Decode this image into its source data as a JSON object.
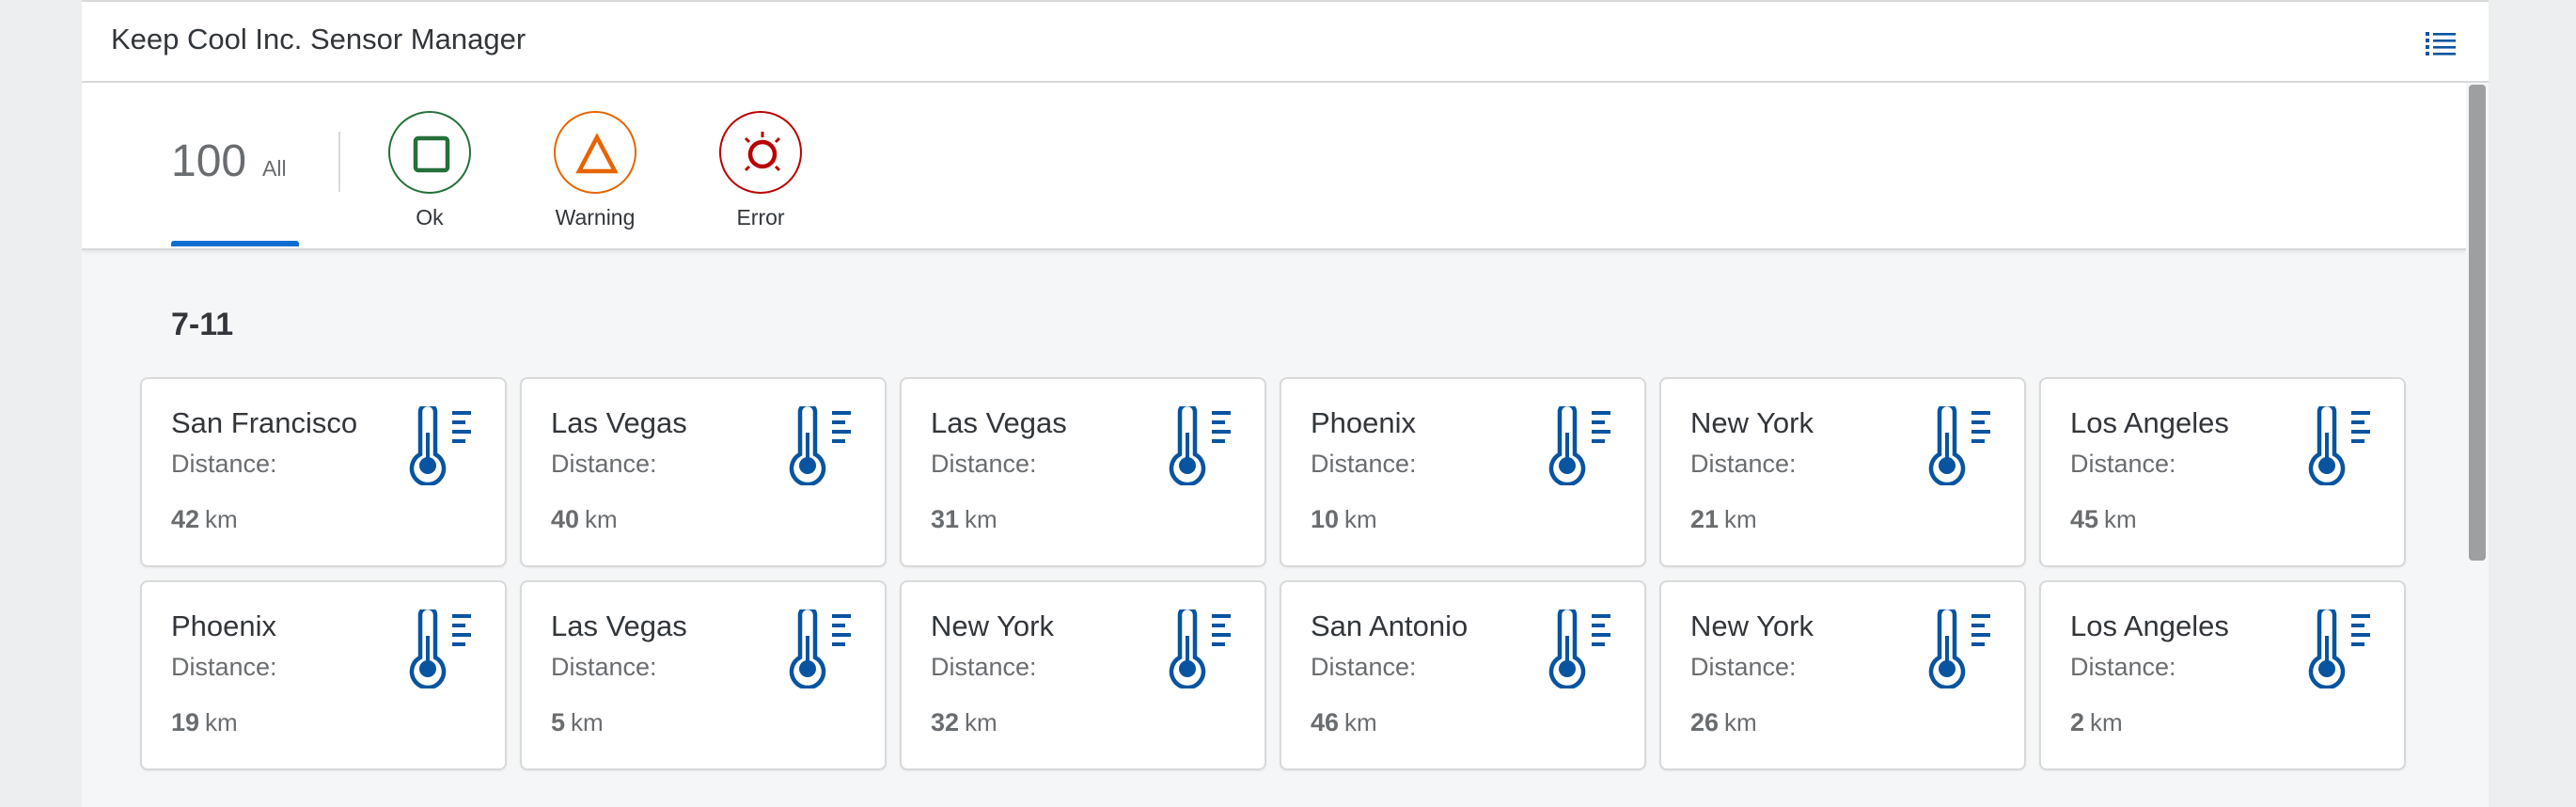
{
  "header": {
    "title": "Keep Cool Inc. Sensor Manager",
    "menu_icon": "list-icon"
  },
  "tabs": {
    "all": {
      "count": "100",
      "label": "All"
    },
    "ok": {
      "label": "Ok",
      "icon": "square-icon",
      "color": "#256f3a"
    },
    "warning": {
      "label": "Warning",
      "icon": "triangle-icon",
      "color": "#e76500"
    },
    "error": {
      "label": "Error",
      "icon": "sun-icon",
      "color": "#bb0000"
    }
  },
  "group": {
    "title": "7-11"
  },
  "colors": {
    "accent": "#0a6ed1",
    "icon_blue": "#0854a0"
  },
  "cards": [
    {
      "city": "San Francisco",
      "distance_label": "Distance:",
      "distance": "42",
      "unit": "km"
    },
    {
      "city": "Las Vegas",
      "distance_label": "Distance:",
      "distance": "40",
      "unit": "km"
    },
    {
      "city": "Las Vegas",
      "distance_label": "Distance:",
      "distance": "31",
      "unit": "km"
    },
    {
      "city": "Phoenix",
      "distance_label": "Distance:",
      "distance": "10",
      "unit": "km"
    },
    {
      "city": "New York",
      "distance_label": "Distance:",
      "distance": "21",
      "unit": "km"
    },
    {
      "city": "Los Angeles",
      "distance_label": "Distance:",
      "distance": "45",
      "unit": "km"
    },
    {
      "city": "Phoenix",
      "distance_label": "Distance:",
      "distance": "19",
      "unit": "km"
    },
    {
      "city": "Las Vegas",
      "distance_label": "Distance:",
      "distance": "5",
      "unit": "km"
    },
    {
      "city": "New York",
      "distance_label": "Distance:",
      "distance": "32",
      "unit": "km"
    },
    {
      "city": "San Antonio",
      "distance_label": "Distance:",
      "distance": "46",
      "unit": "km"
    },
    {
      "city": "New York",
      "distance_label": "Distance:",
      "distance": "26",
      "unit": "km"
    },
    {
      "city": "Los Angeles",
      "distance_label": "Distance:",
      "distance": "2",
      "unit": "km"
    }
  ]
}
